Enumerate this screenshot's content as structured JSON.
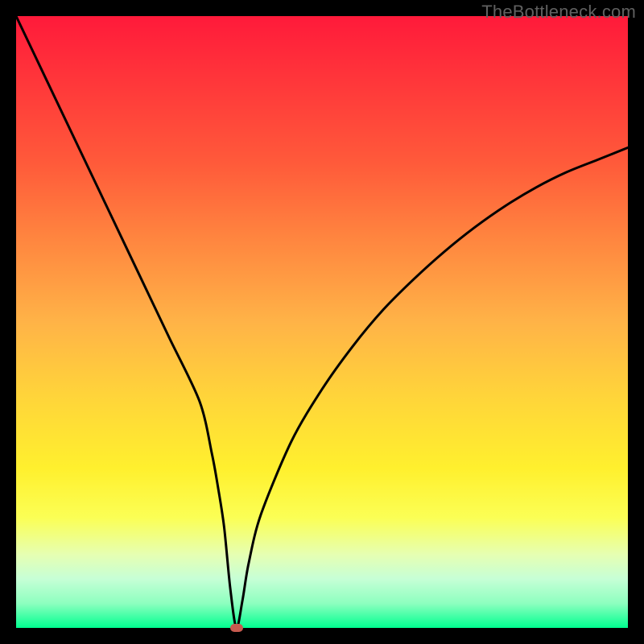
{
  "watermark": "TheBottleneck.com",
  "colors": {
    "border": "#000000",
    "curve": "#000000",
    "marker": "#c75a4f"
  },
  "chart_data": {
    "type": "line",
    "title": "",
    "xlabel": "",
    "ylabel": "",
    "xlim": [
      0,
      100
    ],
    "ylim": [
      0,
      100
    ],
    "grid": false,
    "legend": false,
    "annotations": [
      {
        "text": "TheBottleneck.com",
        "position": "top-right"
      }
    ],
    "series": [
      {
        "name": "bottleneck-curve",
        "x": [
          0,
          5,
          10,
          15,
          20,
          25,
          30,
          32,
          33,
          34,
          35,
          36,
          37,
          38,
          40,
          45,
          50,
          55,
          60,
          65,
          70,
          75,
          80,
          85,
          90,
          95,
          100
        ],
        "values": [
          100,
          89.5,
          79,
          68.5,
          58,
          47.5,
          37,
          28.5,
          23,
          16.5,
          6.5,
          0,
          4.5,
          10.5,
          18.5,
          30.5,
          39,
          46,
          52,
          57,
          61.5,
          65.5,
          69,
          72,
          74.5,
          76.5,
          78.5
        ]
      }
    ],
    "markers": [
      {
        "name": "bottleneck-point",
        "x": 36,
        "y": 0
      }
    ]
  }
}
